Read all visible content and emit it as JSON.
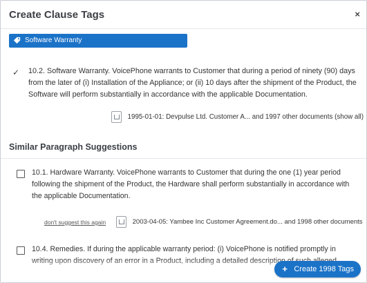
{
  "dialog": {
    "title": "Create Clause Tags",
    "close_icon": "close-icon",
    "close_glyph": "×"
  },
  "tag": {
    "label": "Software Warranty",
    "icon": "tag-icon",
    "color": "#1b73c8"
  },
  "clause": {
    "checked": true,
    "check_glyph": "✓",
    "text": "10.2. Software Warranty. VoicePhone warrants to Customer that during a period of ninety (90) days from the later of (i) Installation of the Appliance; or (ii) 10 days after the shipment of the Product, the Software will perform substantially in accordance with the applicable Documentation.",
    "source": "1995-01-01: Devpulse Ltd. Customer A...  and 1997 other documents (show all)"
  },
  "suggestions": {
    "title": "Similar Paragraph Suggestions",
    "items": [
      {
        "checked": false,
        "text": "10.1. Hardware Warranty. VoicePhone warrants to Customer that during the one (1) year period following the shipment of the Product, the Hardware shall perform substantially in accordance with the applicable Documentation.",
        "dont_suggest": "don't suggest this again",
        "source": "2003-04-05: Yambee Inc Customer Agreement.do...  and 1998 other documents"
      },
      {
        "checked": false,
        "text": "10.4. Remedies. If during the applicable warranty period: (i) VoicePhone is notified promptly in writing upon discovery of an error in a Product, including a detailed description of such alleged"
      }
    ]
  },
  "footer": {
    "create_label": "Create 1998 Tags",
    "create_icon": "plus-icon",
    "plus_glyph": "+",
    "accent": "#1b73c8"
  }
}
